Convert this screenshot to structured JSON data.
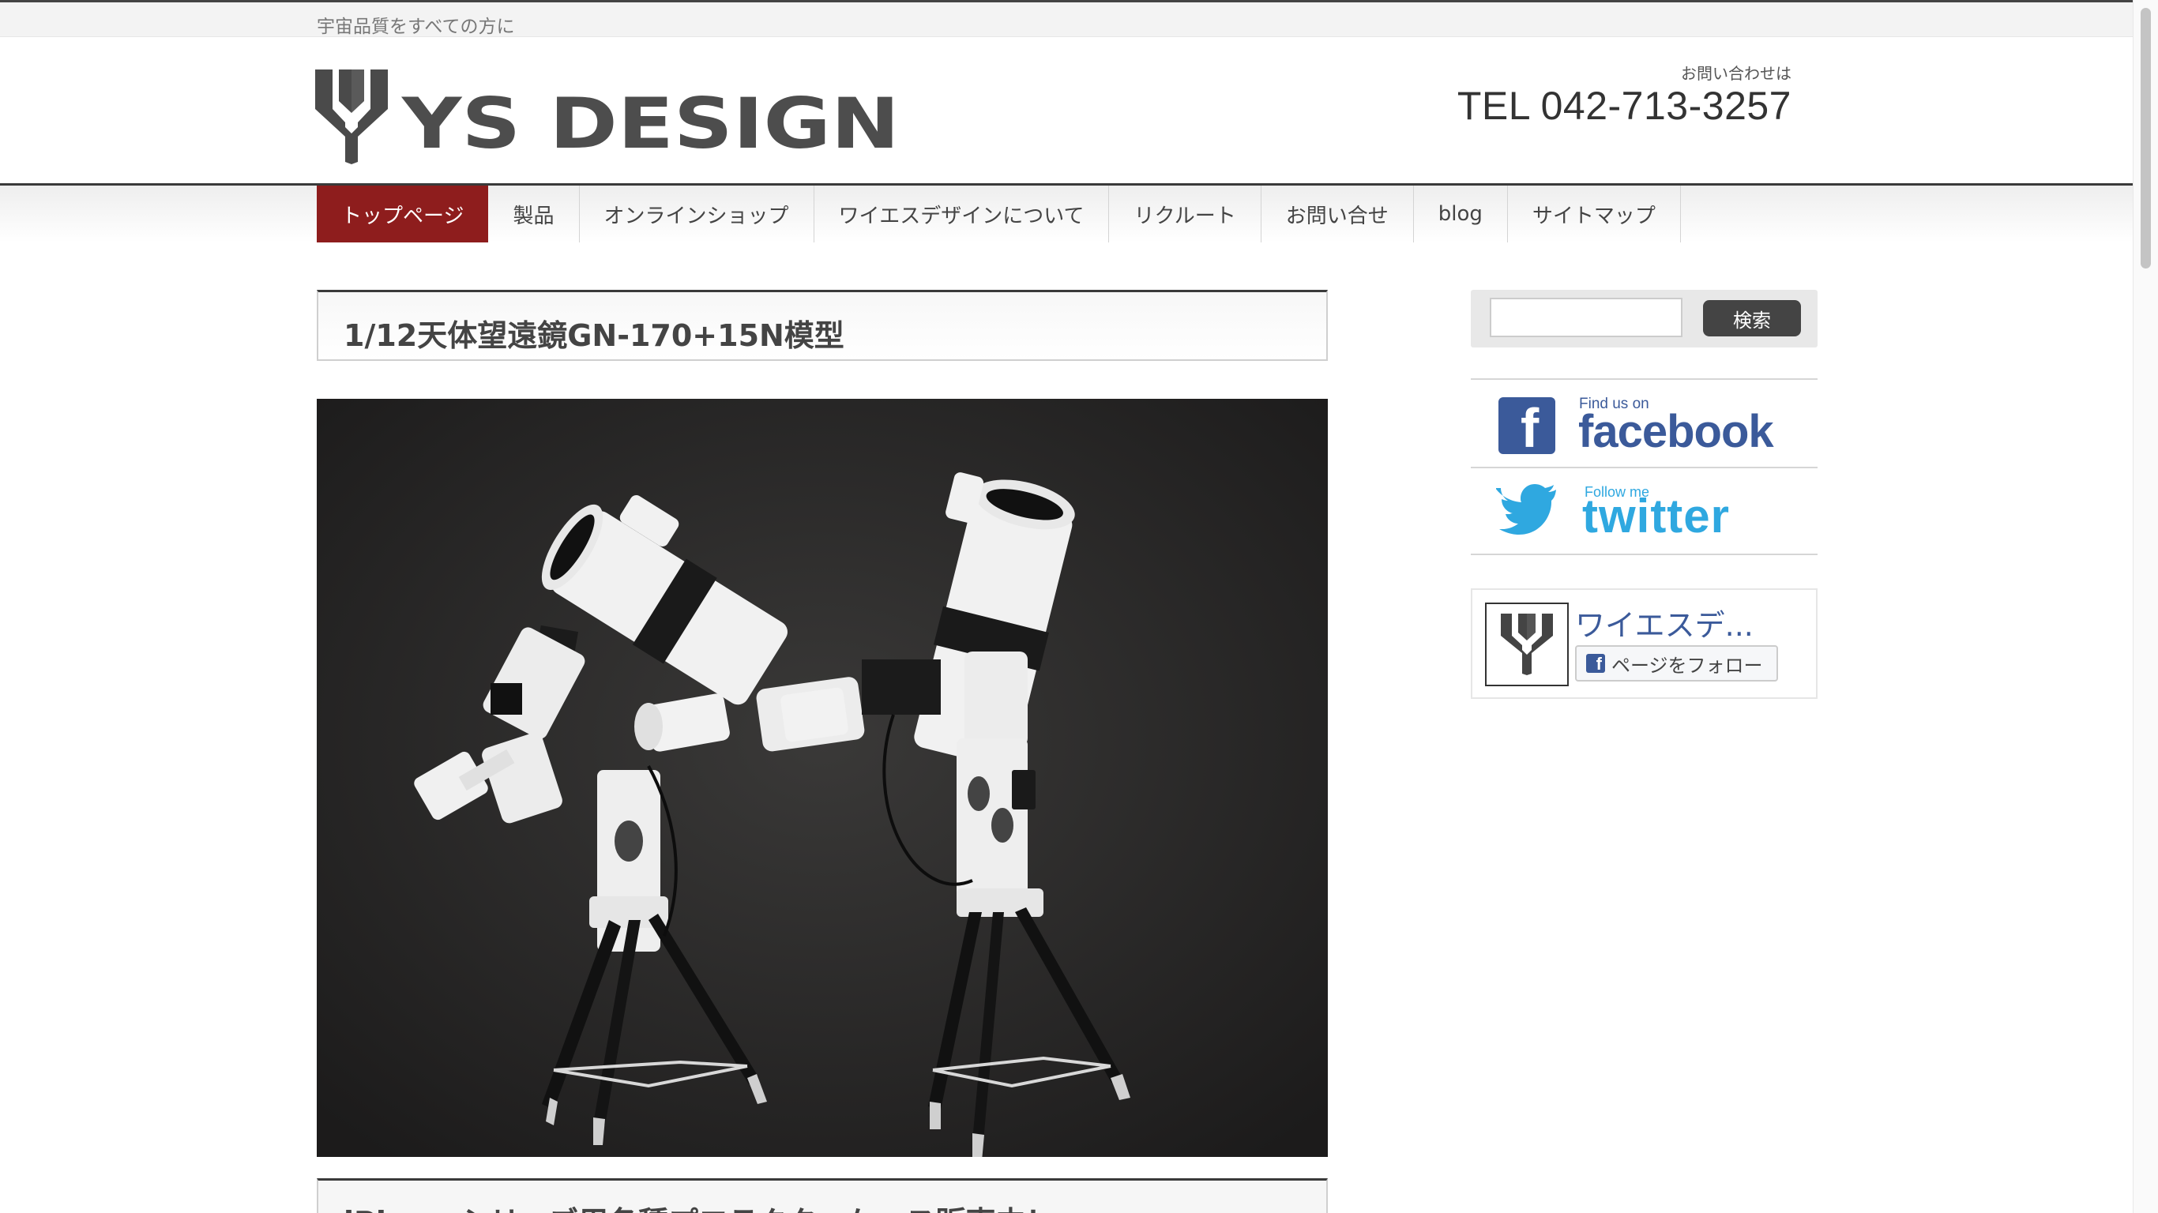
{
  "site": {
    "tagline": "宇宙品質をすべての方に",
    "logo_text": "YS DESIGN",
    "contact_caption": "お問い合わせは",
    "tel": "TEL 042-713-3257"
  },
  "nav": {
    "items": [
      {
        "label": "トップページ",
        "active": true
      },
      {
        "label": "製品"
      },
      {
        "label": "オンラインショップ"
      },
      {
        "label": "ワイエスデザインについて"
      },
      {
        "label": "リクルート"
      },
      {
        "label": "お問い合せ"
      },
      {
        "label": "blog"
      },
      {
        "label": "サイトマップ"
      }
    ]
  },
  "main": {
    "post_title": "1/12天体望遠鏡GN-170+15N模型",
    "next_post_title_partial": "iPhoneシリーズ用各種プロテクターケース販売中！"
  },
  "sidebar": {
    "search": {
      "value": "",
      "button_label": "検索"
    },
    "facebook": {
      "small": "Find us on",
      "big": "facebook",
      "icon": "facebook-f-icon"
    },
    "twitter": {
      "small": "Follow me",
      "big": "twitter",
      "icon": "twitter-bird-icon"
    },
    "fb_widget": {
      "page_name": "ワイエスデ...",
      "follow_label": "ページをフォロー"
    }
  },
  "colors": {
    "nav_active": "#8e1d1d",
    "facebook": "#3b5a9a",
    "twitter": "#2fa8e0",
    "search_button": "#444444"
  }
}
